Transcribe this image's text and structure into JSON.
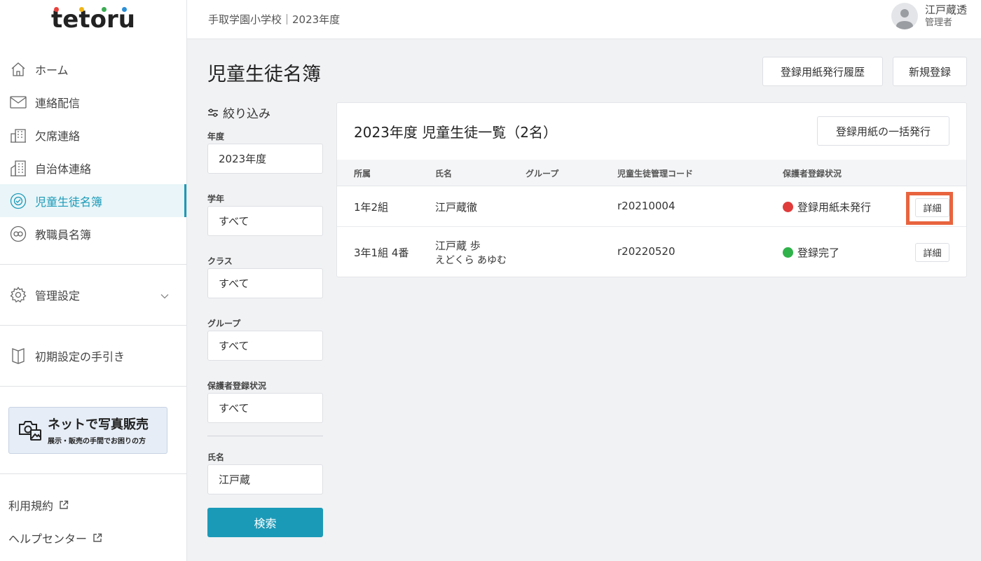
{
  "sidebar": {
    "logo": "tetoru",
    "nav": [
      {
        "label": "ホーム",
        "icon": "home-icon"
      },
      {
        "label": "連絡配信",
        "icon": "mail-icon"
      },
      {
        "label": "欠席連絡",
        "icon": "school-icon"
      },
      {
        "label": "自治体連絡",
        "icon": "building-icon"
      },
      {
        "label": "児童生徒名簿",
        "icon": "student-roster-icon",
        "active": true
      },
      {
        "label": "教職員名簿",
        "icon": "teacher-roster-icon"
      }
    ],
    "settings_label": "管理設定",
    "guide_label": "初期設定の手引き",
    "banner": {
      "title": "ネットで写真販売",
      "subtitle": "展示・販売の手間でお困りの方"
    },
    "terms_label": "利用規約",
    "help_label": "ヘルプセンター"
  },
  "header": {
    "breadcrumb": "手取学園小学校｜2023年度",
    "user_name": "江戸蔵透",
    "user_role": "管理者"
  },
  "page": {
    "title": "児童生徒名簿",
    "history_button": "登録用紙発行履歴",
    "new_button": "新規登録"
  },
  "filter": {
    "title": "絞り込み",
    "year_label": "年度",
    "year_value": "2023年度",
    "grade_label": "学年",
    "grade_value": "すべて",
    "class_label": "クラス",
    "class_value": "すべて",
    "group_label": "グループ",
    "group_value": "すべて",
    "status_label": "保護者登録状況",
    "status_value": "すべて",
    "name_label": "氏名",
    "name_value": "江戸蔵",
    "search_button": "検索"
  },
  "list": {
    "title": "2023年度 児童生徒一覧（2名）",
    "bulk_button": "登録用紙の一括発行",
    "columns": {
      "affiliation": "所属",
      "name": "氏名",
      "group": "グループ",
      "code": "児童生徒管理コード",
      "status": "保護者登録状況"
    },
    "rows": [
      {
        "affiliation": "1年2組",
        "name": "江戸蔵徹",
        "kana": "",
        "group": "",
        "code": "r20210004",
        "status": "登録用紙未発行",
        "status_color": "#e03c3c",
        "detail": "詳細"
      },
      {
        "affiliation": "3年1組 4番",
        "name": "江戸蔵 歩",
        "kana": "えどくら あゆむ",
        "group": "",
        "code": "r20220520",
        "status": "登録完了",
        "status_color": "#2fb24a",
        "detail": "詳細"
      }
    ]
  },
  "colors": {
    "accent": "#1b9ab8",
    "highlight": "#e8643e"
  }
}
